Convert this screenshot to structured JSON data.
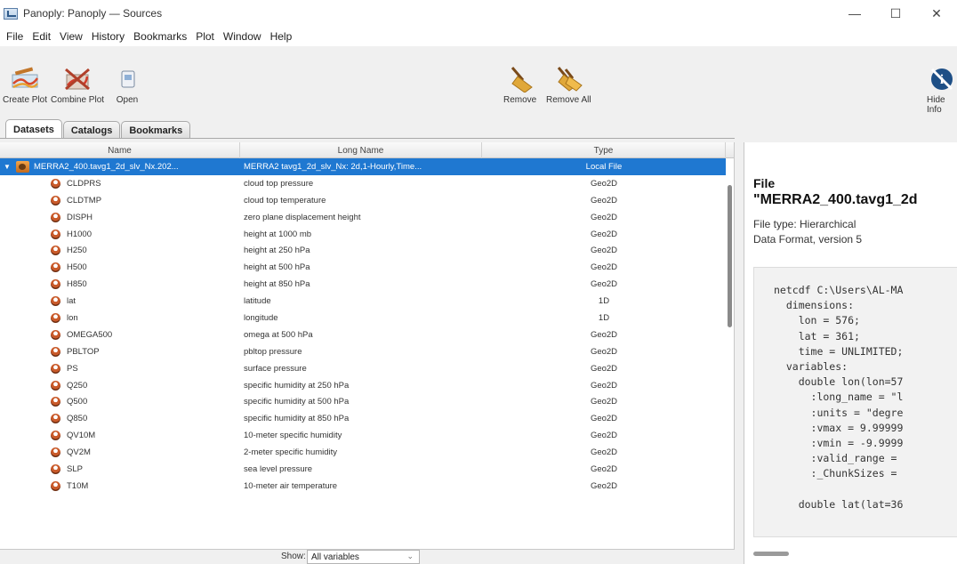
{
  "window": {
    "title": "Panoply: Panoply — Sources",
    "controls": {
      "minimize": "—",
      "maximize": "☐",
      "close": "✕"
    }
  },
  "menu": [
    "File",
    "Edit",
    "View",
    "History",
    "Bookmarks",
    "Plot",
    "Window",
    "Help"
  ],
  "toolbar": {
    "create_plot": "Create Plot",
    "combine_plot": "Combine Plot",
    "open": "Open",
    "remove": "Remove",
    "remove_all": "Remove All",
    "hide_info": "Hide Info"
  },
  "tabs": [
    "Datasets",
    "Catalogs",
    "Bookmarks"
  ],
  "table": {
    "headers": {
      "name": "Name",
      "long_name": "Long Name",
      "type": "Type"
    },
    "file_row": {
      "name": "MERRA2_400.tavg1_2d_slv_Nx.202...",
      "long_name": "MERRA2 tavg1_2d_slv_Nx: 2d,1-Hourly,Time...",
      "type": "Local File"
    },
    "rows": [
      {
        "name": "CLDPRS",
        "long_name": "cloud top pressure",
        "type": "Geo2D"
      },
      {
        "name": "CLDTMP",
        "long_name": "cloud top temperature",
        "type": "Geo2D"
      },
      {
        "name": "DISPH",
        "long_name": "zero plane displacement height",
        "type": "Geo2D"
      },
      {
        "name": "H1000",
        "long_name": "height at 1000 mb",
        "type": "Geo2D"
      },
      {
        "name": "H250",
        "long_name": "height at 250 hPa",
        "type": "Geo2D"
      },
      {
        "name": "H500",
        "long_name": "height at 500 hPa",
        "type": "Geo2D"
      },
      {
        "name": "H850",
        "long_name": "height at 850 hPa",
        "type": "Geo2D"
      },
      {
        "name": "lat",
        "long_name": "latitude",
        "type": "1D"
      },
      {
        "name": "lon",
        "long_name": "longitude",
        "type": "1D"
      },
      {
        "name": "OMEGA500",
        "long_name": "omega at 500 hPa",
        "type": "Geo2D"
      },
      {
        "name": "PBLTOP",
        "long_name": "pbltop pressure",
        "type": "Geo2D"
      },
      {
        "name": "PS",
        "long_name": "surface pressure",
        "type": "Geo2D"
      },
      {
        "name": "Q250",
        "long_name": "specific humidity at 250 hPa",
        "type": "Geo2D"
      },
      {
        "name": "Q500",
        "long_name": "specific humidity at 500 hPa",
        "type": "Geo2D"
      },
      {
        "name": "Q850",
        "long_name": "specific humidity at 850 hPa",
        "type": "Geo2D"
      },
      {
        "name": "QV10M",
        "long_name": "10-meter specific humidity",
        "type": "Geo2D"
      },
      {
        "name": "QV2M",
        "long_name": "2-meter specific humidity",
        "type": "Geo2D"
      },
      {
        "name": "SLP",
        "long_name": "sea level pressure",
        "type": "Geo2D"
      },
      {
        "name": "T10M",
        "long_name": "10-meter air temperature",
        "type": "Geo2D"
      }
    ]
  },
  "show": {
    "label": "Show:",
    "value": "All variables"
  },
  "info": {
    "heading": "File",
    "title": "\"MERRA2_400.tavg1_2d",
    "file_type": "File type: Hierarchical Data Format, version 5",
    "code": [
      "netcdf C:\\Users\\AL-MA",
      "  dimensions:",
      "    lon = 576;",
      "    lat = 361;",
      "    time = UNLIMITED;",
      "  variables:",
      "    double lon(lon=57",
      "      :long_name = \"l",
      "      :units = \"degre",
      "      :vmax = 9.99999",
      "      :vmin = -9.9999",
      "      :valid_range = ",
      "      :_ChunkSizes = ",
      "",
      "    double lat(lat=36"
    ]
  }
}
